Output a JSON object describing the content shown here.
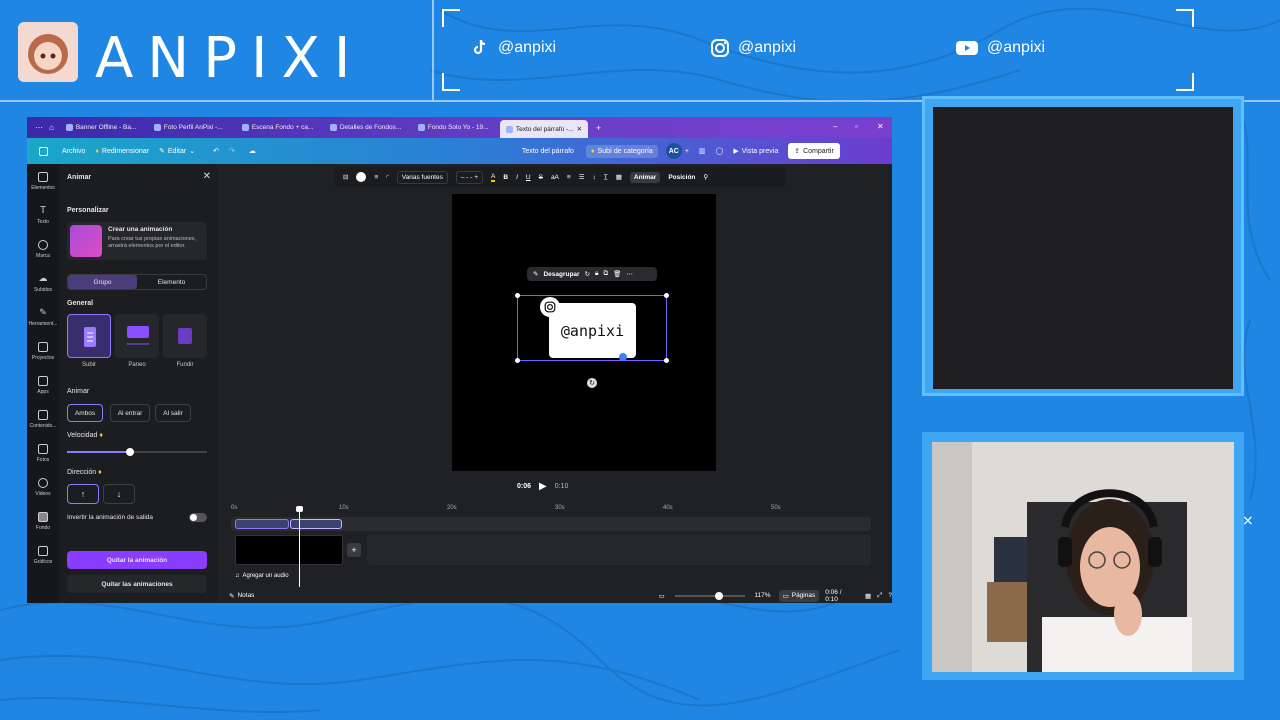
{
  "brand": {
    "name": "ANPIXI"
  },
  "social": [
    {
      "icon": "tiktok-icon",
      "handle": "@anpixi"
    },
    {
      "icon": "instagram-icon",
      "handle": "@anpixi"
    },
    {
      "icon": "youtube-icon",
      "handle": "@anpixi"
    }
  ],
  "browser": {
    "tabs": [
      "Banner Offline - Ba...",
      "Foto Perfil AnPixi -...",
      "Escena Fondo + ca...",
      "Detalles de Fondos...",
      "Fondo Solo Yo - 19...",
      "Texto del párrafo -..."
    ],
    "new_tab": "+",
    "window_buttons": [
      "–",
      "▫",
      "✕"
    ]
  },
  "toolbar": {
    "archivo": "Archivo",
    "redimensionar": "Redimensionar",
    "editar": "Editar",
    "doc_title": "Texto del párrafo",
    "subir": "Subí de categoría",
    "avatar": "AC",
    "vista_previa": "Vista previa",
    "compartir": "Compartir"
  },
  "sidebar": [
    "Elementos",
    "Texto",
    "Marca",
    "Subidos",
    "Herramient...",
    "Proyectos",
    "Apps",
    "Contenido...",
    "Fotos",
    "Videos",
    "Fondo",
    "Gráficos"
  ],
  "panel": {
    "title": "Animar",
    "personalizar": "Personalizar",
    "card_title": "Crear una animación",
    "card_desc": "Para crear tus propias animaciones, arrastrá elementos por el editor.",
    "seg": [
      "Grupo",
      "Elemento"
    ],
    "general": "General",
    "animations": [
      "Subir",
      "Paneo",
      "Fundir"
    ],
    "animar": "Animar",
    "modes": [
      "Ambos",
      "Al entrar",
      "Al salir"
    ],
    "velocidad": "Velocidad",
    "velocidad_value": 0.45,
    "direccion": "Dirección",
    "invertir": "Invertir la animación de salida",
    "quitar": "Quitar la animación",
    "quitar_todas": "Quitar las animaciones"
  },
  "format": {
    "font": "Varias fuentes",
    "size": "- -",
    "animar": "Animar",
    "posicion": "Posición"
  },
  "canvas": {
    "text": "@anpixi",
    "context": "Desagrupar"
  },
  "player": {
    "current": "0:06",
    "total": "0:10"
  },
  "timeline": {
    "ticks": [
      "0s",
      "10s",
      "20s",
      "30s",
      "40s",
      "50s"
    ],
    "audio": "Agregar un audio"
  },
  "footer": {
    "notas": "Notas",
    "zoom": "117%",
    "paginas": "Páginas",
    "time": "0:06 / 0:10"
  }
}
